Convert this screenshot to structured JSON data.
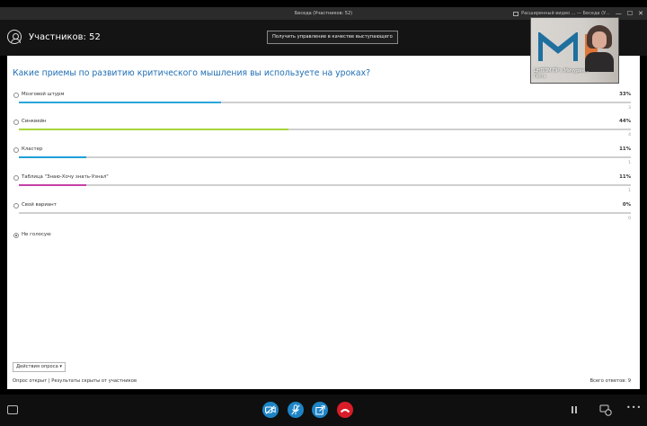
{
  "titlebar": {
    "title": "Беседа (Участников: 52)",
    "mini_label": "Расширенный видео ... — Беседа (У...",
    "minimize": "—",
    "maximize": "☐",
    "close": "✕"
  },
  "topbar": {
    "participants": "Участников: 52",
    "present_button": "Получить управление в качестве выступающего"
  },
  "video": {
    "name": "ЦНППМ ПР г.Мичурин...",
    "role": "Гость"
  },
  "poll": {
    "question": "Какие приемы по развитию критического мышления вы используете на уроках?",
    "options": [
      {
        "label": "Мозговой штурм",
        "percent": "33%",
        "count": "3",
        "fraction": 0.33,
        "color": "#2aa6db"
      },
      {
        "label": "Синквейн",
        "percent": "44%",
        "count": "4",
        "fraction": 0.44,
        "color": "#a6d63c"
      },
      {
        "label": "Кластер",
        "percent": "11%",
        "count": "1",
        "fraction": 0.11,
        "color": "#1fa0d8"
      },
      {
        "label": "Таблица \"Знаю-Хочу знать-Узнал\"",
        "percent": "11%",
        "count": "1",
        "fraction": 0.11,
        "color": "#c540a6"
      },
      {
        "label": "Свой вариант",
        "percent": "0%",
        "count": "0",
        "fraction": 0,
        "color": "#999999"
      }
    ],
    "not_voted": "Не голосую",
    "actions_button": "Действия опроса ▾",
    "status_left": "Опрос открыт  |  Результаты скрыты от участников",
    "total_votes": "Всего ответов: 9"
  },
  "controls": {
    "icons": [
      "chat-icon",
      "video-off-icon",
      "mic-icon",
      "share-icon",
      "hangup-icon",
      "pause-icon",
      "device-icon",
      "more-icon"
    ],
    "colors": {
      "blue": "#1d84c6",
      "red": "#d81d28"
    },
    "more": "•••"
  }
}
